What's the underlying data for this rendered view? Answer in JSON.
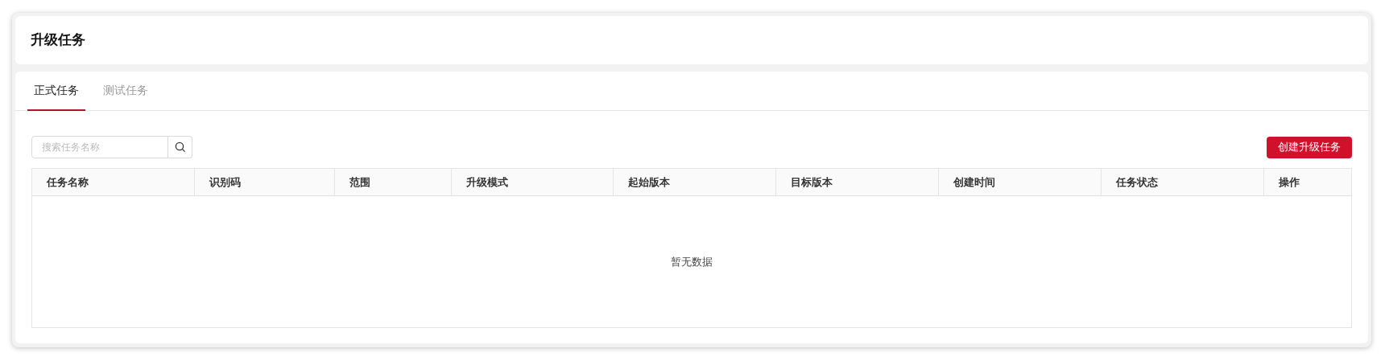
{
  "page_title": "升级任务",
  "tabs": [
    {
      "label": "正式任务",
      "selected": true
    },
    {
      "label": "测试任务",
      "selected": false
    }
  ],
  "search": {
    "placeholder": "搜索任务名称"
  },
  "create_button": "创建升级任务",
  "table": {
    "columns": [
      "任务名称",
      "识别码",
      "范围",
      "升级模式",
      "起始版本",
      "目标版本",
      "创建时间",
      "任务状态",
      "操作"
    ],
    "empty_text": "暂无数据"
  }
}
